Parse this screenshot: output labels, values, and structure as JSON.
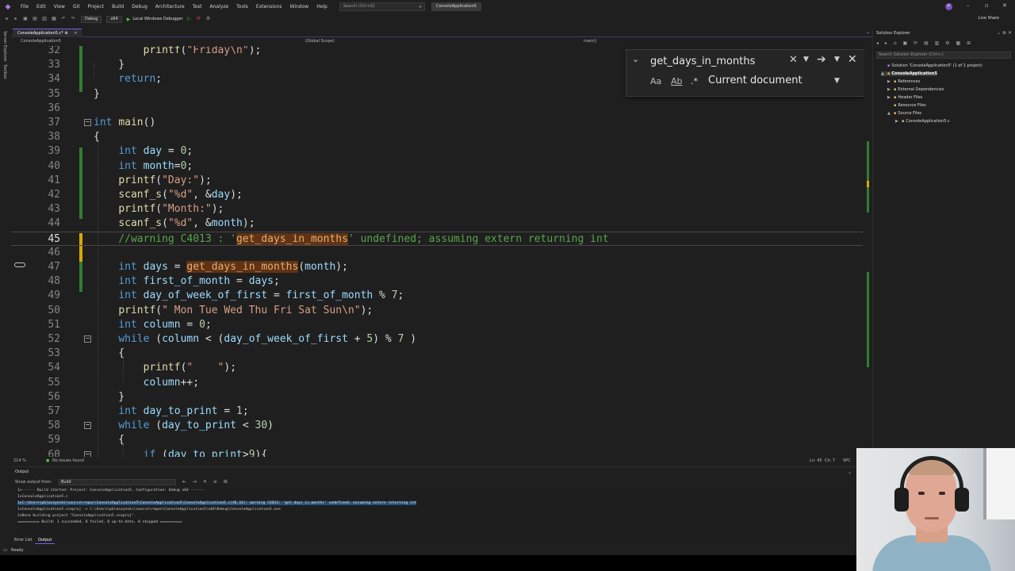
{
  "menubar": {
    "items": [
      "File",
      "Edit",
      "View",
      "Git",
      "Project",
      "Build",
      "Debug",
      "Architecture",
      "Test",
      "Analyze",
      "Tools",
      "Extensions",
      "Window",
      "Help"
    ],
    "search_placeholder": "Search (Ctrl+Q)",
    "project_name": "ConsoleApplication5",
    "avatar_initial": "P"
  },
  "toolbar": {
    "config": "Debug",
    "platform": "x64",
    "run_label": "Local Windows Debugger",
    "live_share": "Live Share"
  },
  "left_strip": {
    "server_explorer": "Server Explorer",
    "toolbox": "Toolbox"
  },
  "document_tab": {
    "label": "ConsoleApplication5.c*",
    "pin": "⊕",
    "close": "✕"
  },
  "navbar": {
    "project": "ConsoleApplication5",
    "scope": "(Global Scope)",
    "member": "main()"
  },
  "editor": {
    "lines": [
      {
        "n": "32",
        "html": "        <span class=\"fn\">printf</span>(<span class=\"st\">\"Friday\\n\"</span>);"
      },
      {
        "n": "33",
        "html": "    }"
      },
      {
        "n": "34",
        "html": "    <span class=\"kw\">return</span>;"
      },
      {
        "n": "35",
        "html": "}"
      },
      {
        "n": "36",
        "html": ""
      },
      {
        "n": "37",
        "html": "<span class=\"kw\">int</span> <span class=\"fn\">main</span>()"
      },
      {
        "n": "38",
        "html": "{"
      },
      {
        "n": "39",
        "html": "    <span class=\"kw\">int</span> <span class=\"id\">day</span> = <span class=\"nm\">0</span>;"
      },
      {
        "n": "40",
        "html": "    <span class=\"kw\">int</span> <span class=\"id\">month</span>=<span class=\"nm\">0</span>;"
      },
      {
        "n": "41",
        "html": "    <span class=\"fn\">printf</span>(<span class=\"st\">\"Day:\"</span>);"
      },
      {
        "n": "42",
        "html": "    <span class=\"fn\">scanf_s</span>(<span class=\"st\">\"%d\"</span>, &amp;<span class=\"id\">day</span>);"
      },
      {
        "n": "43",
        "html": "    <span class=\"fn\">printf</span>(<span class=\"st\">\"Month:\"</span>);"
      },
      {
        "n": "44",
        "html": "    <span class=\"fn\">scanf_s</span>(<span class=\"st\">\"%d\"</span>, &amp;<span class=\"id\">month</span>);"
      },
      {
        "n": "45",
        "html": "    <span class=\"cm\">//warning C4013 : '<span class=\"hl\">get_days_in_months</span>' undefined; assuming extern returning int</span>"
      },
      {
        "n": "46",
        "html": ""
      },
      {
        "n": "47",
        "html": "    <span class=\"kw\">int</span> <span class=\"id\">days</span> = <span class=\"hl\">get_days_in_months</span>(<span class=\"id\">month</span>);"
      },
      {
        "n": "48",
        "html": "    <span class=\"kw\">int</span> <span class=\"id\">first_of_month</span> = <span class=\"id\">days</span>;"
      },
      {
        "n": "49",
        "html": "    <span class=\"kw\">int</span> <span class=\"id\">day_of_week_of_first</span> = <span class=\"id\">first_of_month</span> % <span class=\"nm\">7</span>;"
      },
      {
        "n": "50",
        "html": "    <span class=\"fn\">printf</span>(<span class=\"st\">\" Mon Tue Wed Thu Fri Sat Sun\\n\"</span>);"
      },
      {
        "n": "51",
        "html": "    <span class=\"kw\">int</span> <span class=\"id\">column</span> = <span class=\"nm\">0</span>;"
      },
      {
        "n": "52",
        "html": "    <span class=\"kw\">while</span> (<span class=\"id\">column</span> &lt; (<span class=\"id\">day_of_week_of_first</span> + <span class=\"nm\">5</span>) % <span class=\"nm\">7</span> )"
      },
      {
        "n": "53",
        "html": "    {"
      },
      {
        "n": "54",
        "html": "        <span class=\"fn\">printf</span>(<span class=\"st\">\"    \"</span>);"
      },
      {
        "n": "55",
        "html": "        <span class=\"id\">column</span>++;"
      },
      {
        "n": "56",
        "html": "    }"
      },
      {
        "n": "57",
        "html": "    <span class=\"kw\">int</span> <span class=\"id\">day_to_print</span> = <span class=\"nm\">1</span>;"
      },
      {
        "n": "58",
        "html": "    <span class=\"kw\">while</span> (<span class=\"id\">day_to_print</span> &lt; <span class=\"nm\">30</span>)"
      },
      {
        "n": "59",
        "html": "    {"
      },
      {
        "n": "60",
        "html": "        <span class=\"kw\">if</span> (<span class=\"id\">day_to_print</span>&gt;<span class=\"nm\">9</span>){"
      }
    ]
  },
  "find_widget": {
    "query": "get_days_in_months",
    "scope": "Current document",
    "match_case": "Aa",
    "whole_word": "Ab",
    "regex": ".*"
  },
  "editor_status": {
    "zoom": "214 %",
    "issues": "No issues found",
    "line": "Ln: 45",
    "col": "Ch: 7",
    "mode": "SPC"
  },
  "solution_explorer": {
    "title": "Solution Explorer",
    "search_placeholder": "Search Solution Explorer (Ctrl+;)",
    "items": [
      {
        "label": "Solution 'ConsoleApplication5' (1 of 1 project)",
        "arrow": ""
      },
      {
        "label": "ConsoleApplication5",
        "arrow": "▲"
      },
      {
        "label": "References",
        "arrow": "▶"
      },
      {
        "label": "External Dependencies",
        "arrow": "▶"
      },
      {
        "label": "Header Files",
        "arrow": "▶"
      },
      {
        "label": "Resource Files",
        "arrow": ""
      },
      {
        "label": "Source Files",
        "arrow": "▲"
      },
      {
        "label": "ConsoleApplication5.c",
        "arrow": "▶"
      }
    ]
  },
  "output": {
    "title": "Output",
    "show_from_label": "Show output from:",
    "source": "Build",
    "lines": [
      "1>------ Build started: Project: ConsoleApplication5, Configuration: Debug x64 ------",
      "1>ConsoleApplication5.c",
      "1>C:\\Users\\pblaszynski\\source\\repos\\ConsoleApplication5\\ConsoleApplication5\\ConsoleApplication5.c(46,16): warning C4013: 'get_days_in_months' undefined; assuming extern returning int",
      "1>ConsoleApplication5.vcxproj -> C:\\Users\\pblaszynski\\source\\repos\\ConsoleApplication5\\x64\\Debug\\ConsoleApplication5.exe",
      "1>Done building project \"ConsoleApplication5.vcxproj\".",
      "========== Build: 1 succeeded, 0 failed, 0 up-to-date, 0 skipped =========="
    ]
  },
  "bottom_tabs": [
    "Error List",
    "Output"
  ],
  "status": "Ready"
}
